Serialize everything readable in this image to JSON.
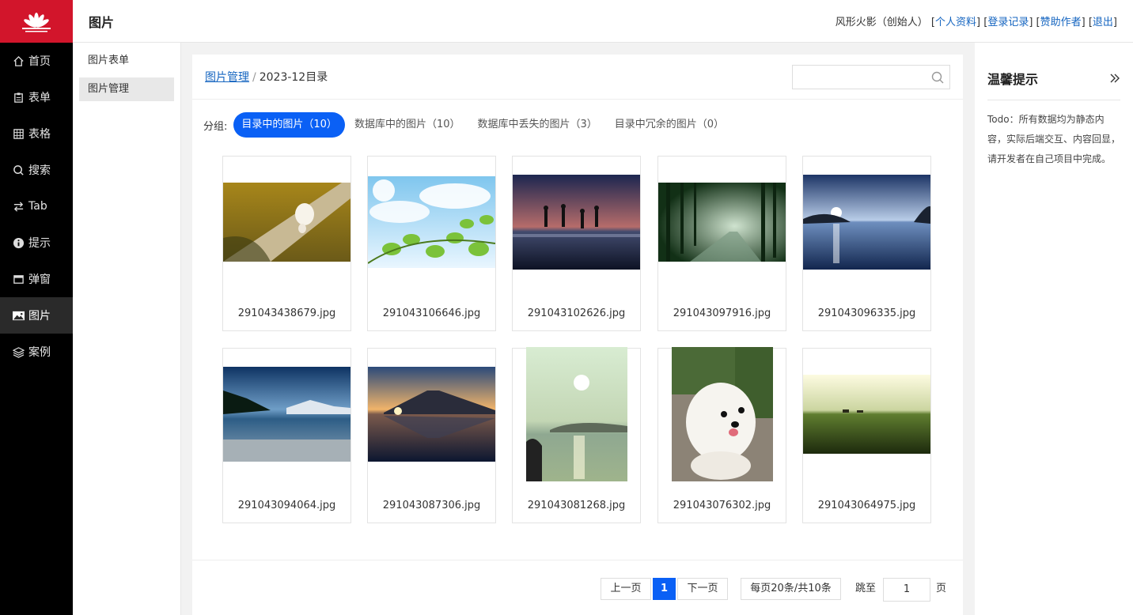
{
  "sidebar": {
    "items": [
      {
        "label": "首页",
        "icon": "home-icon"
      },
      {
        "label": "表单",
        "icon": "form-icon"
      },
      {
        "label": "表格",
        "icon": "table-icon"
      },
      {
        "label": "搜索",
        "icon": "search-icon"
      },
      {
        "label": "Tab",
        "icon": "swap-icon"
      },
      {
        "label": "提示",
        "icon": "info-icon"
      },
      {
        "label": "弹窗",
        "icon": "window-icon"
      },
      {
        "label": "图片",
        "icon": "image-icon"
      },
      {
        "label": "案例",
        "icon": "layers-icon"
      }
    ],
    "active_index": 7
  },
  "header": {
    "title": "图片",
    "user": "风形火影（创始人）",
    "links": [
      "个人资料",
      "登录记录",
      "赞助作者",
      "退出"
    ]
  },
  "submenu": {
    "items": [
      "图片表单",
      "图片管理"
    ],
    "active_index": 1
  },
  "breadcrumb": {
    "root": "图片管理",
    "sep": "/",
    "current": "2023-12目录"
  },
  "search": {
    "placeholder": "",
    "value": ""
  },
  "groups": {
    "label": "分组:",
    "tabs": [
      "目录中的图片（10）",
      "数据库中的图片（10）",
      "数据库中丢失的图片（3）",
      "目录中冗余的图片（0）"
    ],
    "active_index": 0
  },
  "images": [
    {
      "name": "291043438679.jpg",
      "scene": "dog-road"
    },
    {
      "name": "291043106646.jpg",
      "scene": "leaves-sky"
    },
    {
      "name": "291043102626.jpg",
      "scene": "beach-jump"
    },
    {
      "name": "291043097916.jpg",
      "scene": "forest-road"
    },
    {
      "name": "291043096335.jpg",
      "scene": "sea-sunrise"
    },
    {
      "name": "291043094064.jpg",
      "scene": "lake-mountain"
    },
    {
      "name": "291043087306.jpg",
      "scene": "fuji-sunset"
    },
    {
      "name": "291043081268.jpg",
      "scene": "lake-sun"
    },
    {
      "name": "291043076302.jpg",
      "scene": "puppy"
    },
    {
      "name": "291043064975.jpg",
      "scene": "green-field"
    }
  ],
  "pagination": {
    "prev": "上一页",
    "current": "1",
    "next": "下一页",
    "info": "每页20条/共10条",
    "jump_label": "跳至",
    "jump_value": "1",
    "page_suffix": "页"
  },
  "tips": {
    "title": "温馨提示",
    "body": "Todo：所有数据均为静态内容，实际后端交互、内容回显，请开发者在自己项目中完成。"
  },
  "colors": {
    "brand": "#d2152b",
    "accent": "#0a60f5",
    "link": "#1565c0"
  }
}
